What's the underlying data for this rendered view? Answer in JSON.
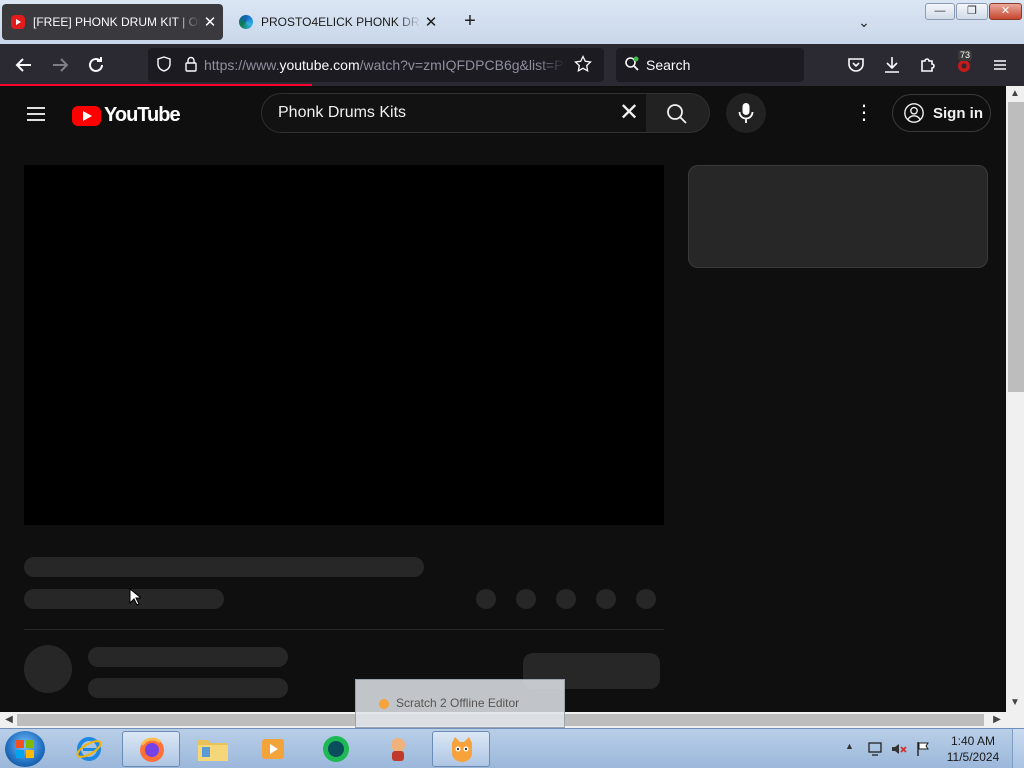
{
  "browser": {
    "tabs": [
      {
        "title": "[FREE] PHONK DRUM KIT | ORIGINAL",
        "close": "✕"
      },
      {
        "title": "PROSTO4ELICK PHONK DRUM KIT",
        "close": "✕"
      }
    ],
    "new_tab": "+",
    "tab_list": "⌄",
    "window": {
      "minimize": "—",
      "maximize": "❐",
      "close": "✕"
    },
    "url_prefix": "https://www.",
    "url_domain": "youtube.com",
    "url_rest": "/watch?v=zmIQFDPCB6g&list=PL",
    "search_placeholder": "Search",
    "notification_count": "73"
  },
  "youtube": {
    "logo_text": "YouTube",
    "search_query": "Phonk Drums Kits",
    "clear": "✕",
    "more": "⋮",
    "sign_in": "Sign in"
  },
  "tooltip": {
    "text": "Scratch 2 Offline Editor"
  },
  "taskbar": {
    "time": "1:40 AM",
    "date": "11/5/2024",
    "tray_up": "▲"
  },
  "colors": {
    "youtube_bg": "#0f0f0f",
    "youtube_red": "#ff0000",
    "skeleton": "#272727",
    "browser_toolbar": "#2b2a33"
  }
}
